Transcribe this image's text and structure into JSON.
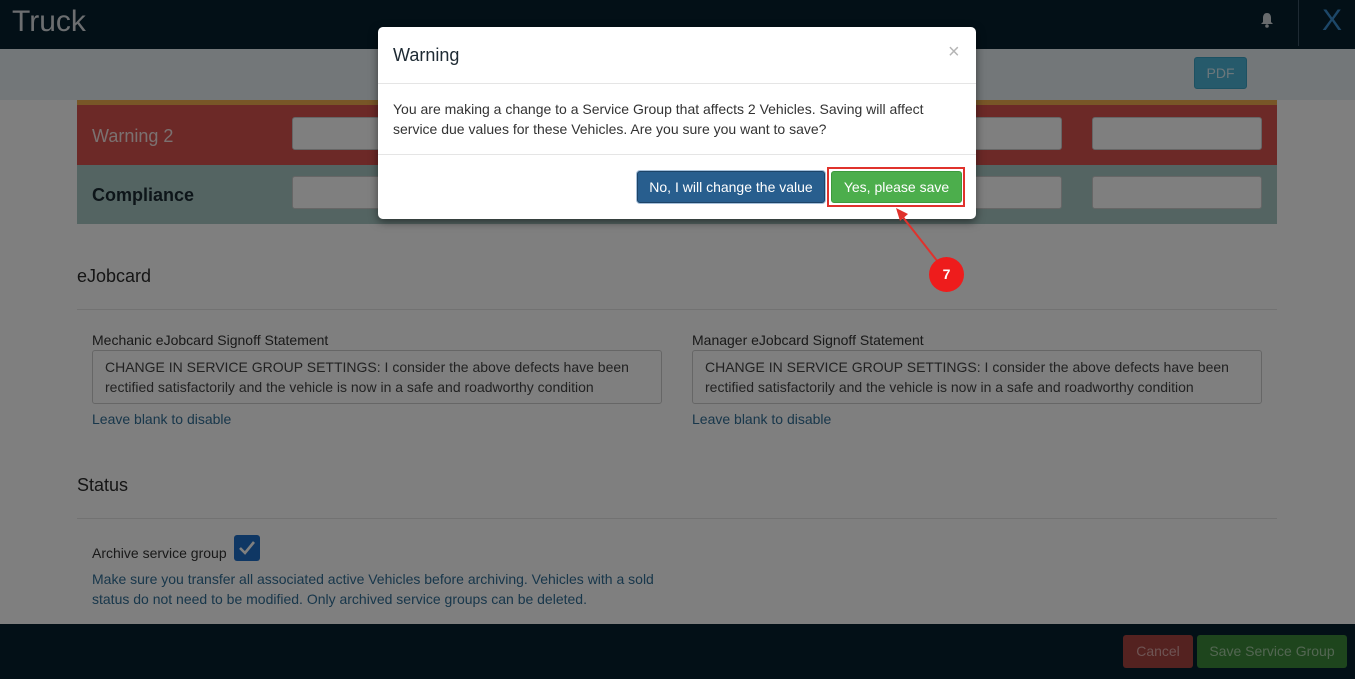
{
  "header": {
    "title": "Truck",
    "close_label": "X"
  },
  "toolbar": {
    "pdf_label": "PDF"
  },
  "thresholds": {
    "warning_label": "Warning 2",
    "compliance_label": "Compliance"
  },
  "ejobcard": {
    "section_title": "eJobcard",
    "mechanic_label": "Mechanic eJobcard Signoff Statement",
    "mechanic_value": "CHANGE IN SERVICE GROUP SETTINGS: I consider the above defects have been rectified satisfactorily and the vehicle is now in a safe and roadworthy condition",
    "mechanic_help": "Leave blank to disable",
    "manager_label": "Manager eJobcard Signoff Statement",
    "manager_value": "CHANGE IN SERVICE GROUP SETTINGS: I consider the above defects have been rectified satisfactorily and the vehicle is now in a safe and roadworthy condition",
    "manager_help": "Leave blank to disable"
  },
  "status": {
    "section_title": "Status",
    "archive_label": "Archive service group",
    "archive_checked": true,
    "archive_help": "Make sure you transfer all associated active Vehicles before archiving. Vehicles with a sold status do not need to be modified. Only archived service groups can be deleted."
  },
  "footer": {
    "cancel_label": "Cancel",
    "save_label": "Save Service Group"
  },
  "modal": {
    "title": "Warning",
    "close_symbol": "×",
    "body": "You are making a change to a Service Group that affects 2 Vehicles. Saving will affect service due values for these Vehicles. Are you sure you want to save?",
    "no_label": "No, I will change the value",
    "yes_label": "Yes, please save"
  },
  "annotation": {
    "step_number": "7",
    "color": "#ee1c1c"
  },
  "colors": {
    "header_bg": "#06202f",
    "warning_red": "#d9534f",
    "compliance_teal": "#a8c9c4",
    "primary_blue": "#285e8e",
    "success_green": "#4cae4c"
  }
}
